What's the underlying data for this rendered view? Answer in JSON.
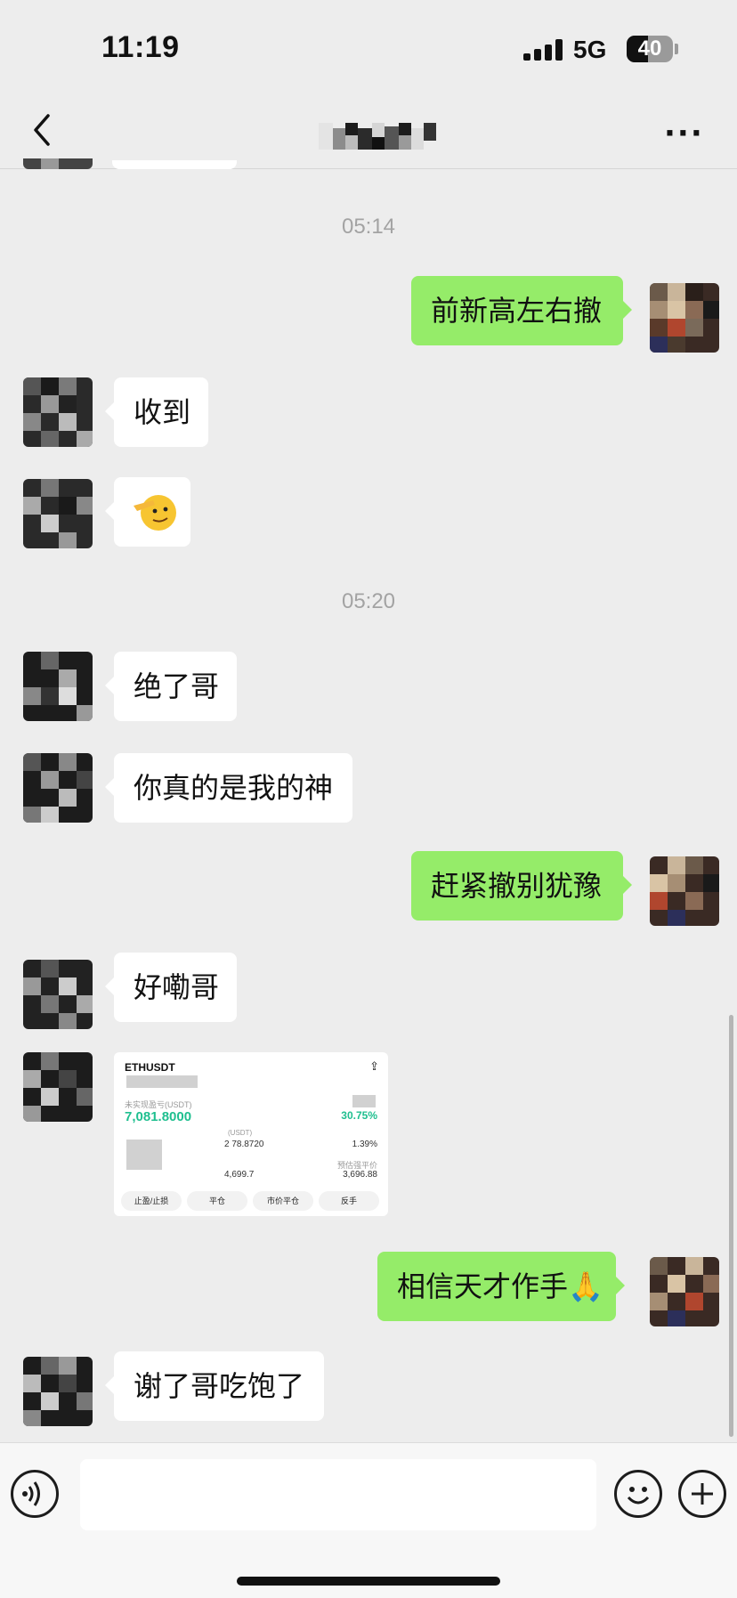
{
  "status_bar": {
    "time": "11:19",
    "network": "5G",
    "battery": "40"
  },
  "nav": {
    "back_icon": "chevron-left-icon",
    "more_label": "···"
  },
  "colors": {
    "background": "#ededed",
    "sent_bubble": "#95ec69",
    "received_bubble": "#ffffff",
    "timestamp": "#a3a3a3",
    "profit_green": "#1fbf8f"
  },
  "messages": {
    "ts1": "05:14",
    "m1": "前新高左右撤",
    "m2": "收到",
    "m3_icon": "saluting-face-emoji",
    "ts2": "05:20",
    "m4": "绝了哥",
    "m5": "你真的是我的神",
    "m6": "赶紧撤别犹豫",
    "m7": "好嘞哥",
    "m9": "相信天才作手🙏",
    "m10": "谢了哥吃饱了"
  },
  "trade_card": {
    "symbol": "ETHUSDT",
    "share_icon": "share-icon",
    "unrealized_label": "未实现盈亏(USDT)",
    "unrealized_value": "7,081.8000",
    "roi": "30.75%",
    "size_label": "(USDT)",
    "size_value": "2 78.8720",
    "margin_ratio": "1.39%",
    "entry_price": "4,699.7",
    "liq_label": "预估强平价",
    "liq_price": "3,696.88",
    "buttons": [
      "止盈/止损",
      "平仓",
      "市价平仓",
      "反手"
    ]
  },
  "input_bar": {
    "voice_icon": "voice-icon",
    "emoji_icon": "smile-icon",
    "plus_icon": "plus-icon"
  }
}
